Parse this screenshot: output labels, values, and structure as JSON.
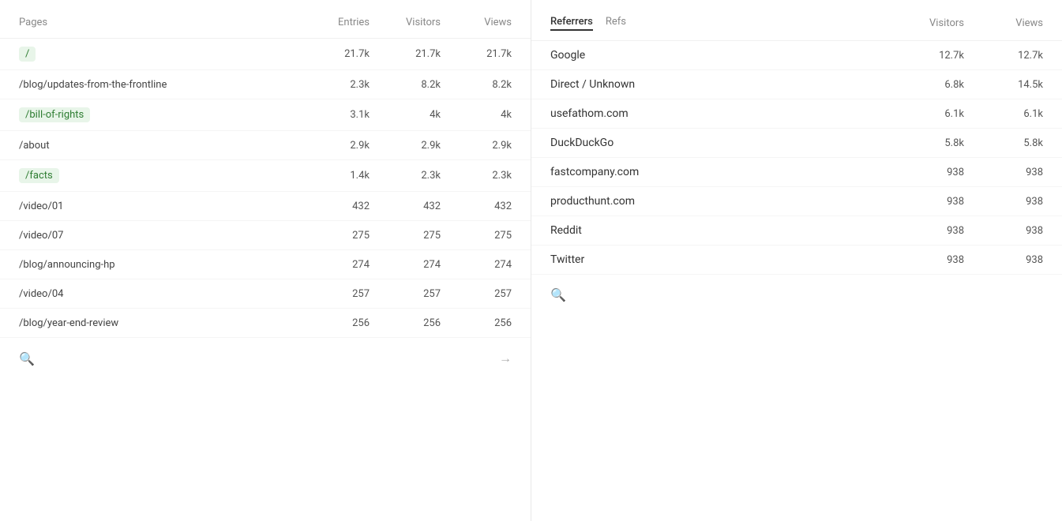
{
  "pages_panel": {
    "header": {
      "pages_label": "Pages",
      "entries_label": "Entries",
      "visitors_label": "Visitors",
      "views_label": "Views"
    },
    "rows": [
      {
        "label": "/",
        "pill": true,
        "entries": "21.7k",
        "visitors": "21.7k",
        "views": "21.7k"
      },
      {
        "label": "/blog/updates-from-the-frontline",
        "pill": false,
        "entries": "2.3k",
        "visitors": "8.2k",
        "views": "8.2k"
      },
      {
        "label": "/bill-of-rights",
        "pill": true,
        "entries": "3.1k",
        "visitors": "4k",
        "views": "4k"
      },
      {
        "label": "/about",
        "pill": false,
        "entries": "2.9k",
        "visitors": "2.9k",
        "views": "2.9k"
      },
      {
        "label": "/facts",
        "pill": true,
        "entries": "1.4k",
        "visitors": "2.3k",
        "views": "2.3k"
      },
      {
        "label": "/video/01",
        "pill": false,
        "entries": "432",
        "visitors": "432",
        "views": "432"
      },
      {
        "label": "/video/07",
        "pill": false,
        "entries": "275",
        "visitors": "275",
        "views": "275"
      },
      {
        "label": "/blog/announcing-hp",
        "pill": false,
        "entries": "274",
        "visitors": "274",
        "views": "274"
      },
      {
        "label": "/video/04",
        "pill": false,
        "entries": "257",
        "visitors": "257",
        "views": "257"
      },
      {
        "label": "/blog/year-end-review",
        "pill": false,
        "entries": "256",
        "visitors": "256",
        "views": "256"
      }
    ],
    "footer": {
      "search_icon": "🔍",
      "arrow_icon": "→"
    }
  },
  "referrers_panel": {
    "tabs": [
      {
        "label": "Referrers",
        "active": true
      },
      {
        "label": "Refs",
        "active": false
      }
    ],
    "header": {
      "visitors_label": "Visitors",
      "views_label": "Views"
    },
    "rows": [
      {
        "label": "Google",
        "pill": true,
        "visitors": "12.7k",
        "views": "12.7k"
      },
      {
        "label": "Direct / Unknown",
        "pill": true,
        "visitors": "6.8k",
        "views": "14.5k"
      },
      {
        "label": "usefathom.com",
        "pill": false,
        "visitors": "6.1k",
        "views": "6.1k"
      },
      {
        "label": "DuckDuckGo",
        "pill": true,
        "visitors": "5.8k",
        "views": "5.8k"
      },
      {
        "label": "fastcompany.com",
        "pill": false,
        "visitors": "938",
        "views": "938"
      },
      {
        "label": "producthunt.com",
        "pill": false,
        "visitors": "938",
        "views": "938"
      },
      {
        "label": "Reddit",
        "pill": false,
        "visitors": "938",
        "views": "938"
      },
      {
        "label": "Twitter",
        "pill": false,
        "visitors": "938",
        "views": "938"
      }
    ],
    "footer": {
      "search_icon": "🔍"
    }
  }
}
